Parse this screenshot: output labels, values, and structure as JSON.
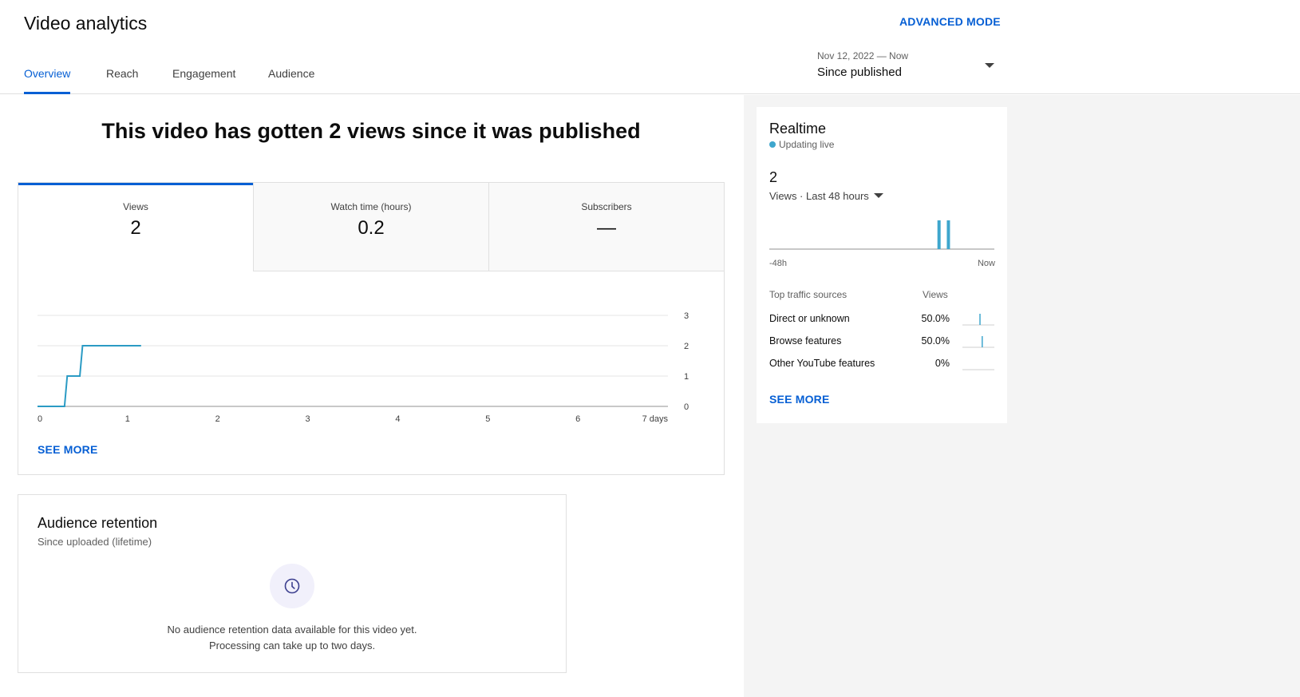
{
  "header": {
    "title": "Video analytics",
    "advanced_mode": "ADVANCED MODE",
    "tabs": [
      {
        "label": "Overview",
        "active": true
      },
      {
        "label": "Reach",
        "active": false
      },
      {
        "label": "Engagement",
        "active": false
      },
      {
        "label": "Audience",
        "active": false
      }
    ],
    "date_range": "Nov 12, 2022 — Now",
    "period_label": "Since published"
  },
  "overview": {
    "headline": "This video has gotten 2 views since it was published",
    "metrics": [
      {
        "label": "Views",
        "value": "2",
        "active": true
      },
      {
        "label": "Watch time (hours)",
        "value": "0.2",
        "active": false
      },
      {
        "label": "Subscribers",
        "value": "—",
        "active": false
      }
    ],
    "see_more": "SEE MORE"
  },
  "chart_data": {
    "type": "line",
    "series": [
      {
        "x": [
          0,
          0.3,
          0.33,
          0.47,
          0.5,
          1.15
        ],
        "y": [
          0,
          0,
          1,
          1,
          2,
          2
        ]
      }
    ],
    "x_ticks": [
      "0",
      "1",
      "2",
      "3",
      "4",
      "5",
      "6",
      "7 days"
    ],
    "y_ticks": [
      "0",
      "1",
      "2",
      "3"
    ],
    "xlim": [
      0,
      7
    ],
    "ylim": [
      0,
      3
    ],
    "grid": true,
    "color": "#2b9bc4"
  },
  "retention": {
    "title": "Audience retention",
    "subtitle": "Since uploaded (lifetime)",
    "icon": "clock-icon",
    "message_line1": "No audience retention data available for this video yet.",
    "message_line2": "Processing can take up to two days."
  },
  "realtime": {
    "title": "Realtime",
    "status": "Updating live",
    "count": "2",
    "metric_label": "Views · Last 48 hours",
    "axis_start": "-48h",
    "axis_end": "Now",
    "bars": [
      {
        "hour_offset": -11.8,
        "views": 1
      },
      {
        "hour_offset": -9.8,
        "views": 1
      }
    ],
    "traffic_header": {
      "source": "Top traffic sources",
      "views": "Views"
    },
    "traffic_sources": [
      {
        "source": "Direct or unknown",
        "pct": "50.0%",
        "spark_position": 0.55
      },
      {
        "source": "Browse features",
        "pct": "50.0%",
        "spark_position": 0.62
      },
      {
        "source": "Other YouTube features",
        "pct": "0%",
        "spark_position": null
      }
    ],
    "see_more": "SEE MORE",
    "accent": "#3ea6cd"
  },
  "colors": {
    "brand_blue": "#065fd4",
    "chart_line": "#2b9bc4",
    "realtime_bar": "#3ea6cd"
  }
}
